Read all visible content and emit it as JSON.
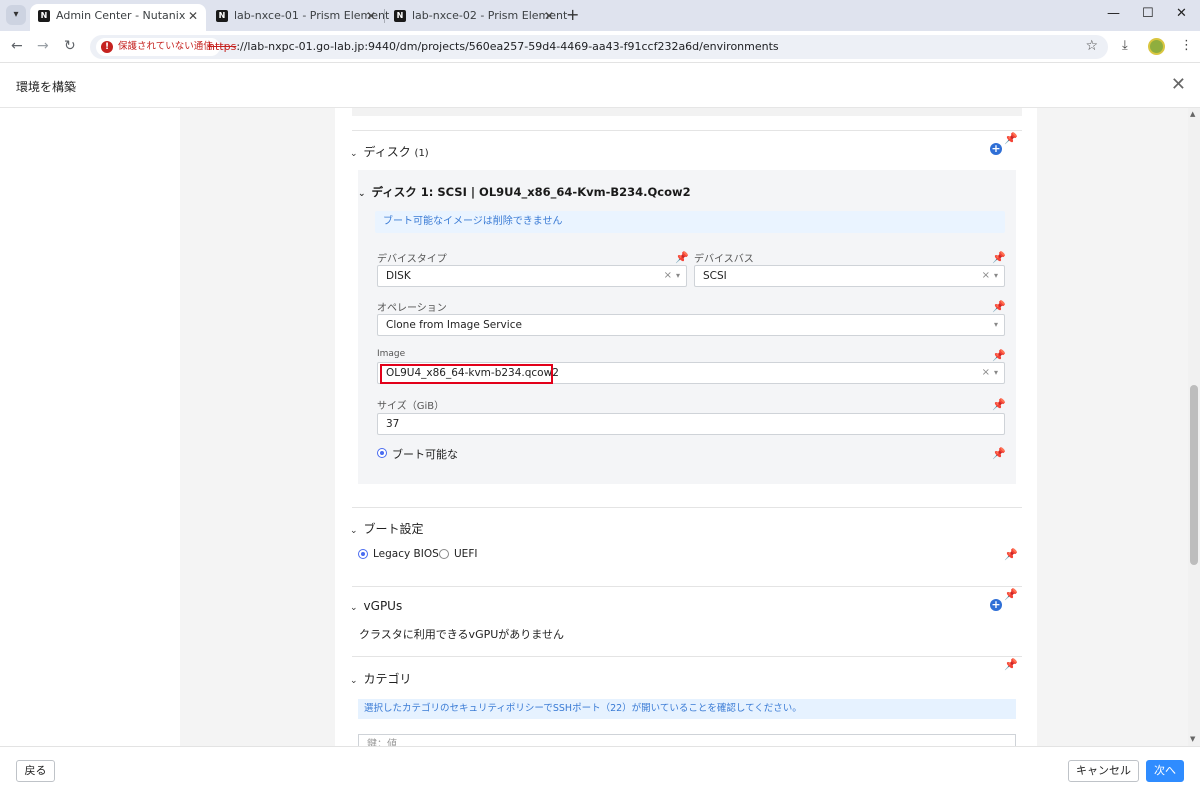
{
  "browser": {
    "tabs": [
      {
        "title": "Admin Center - Nutanix",
        "favicon": "N",
        "active": true
      },
      {
        "title": "lab-nxce-01 - Prism Element",
        "favicon": "N",
        "active": false
      },
      {
        "title": "lab-nxce-02 - Prism Element",
        "favicon": "N",
        "active": false
      }
    ],
    "security_label": "保護されていない通信",
    "url_proto": "https",
    "url_rest": "://lab-nxpc-01.go-lab.jp:9440/dm/projects/560ea257-59d4-4469-aa43-f91ccf232a6d/environments",
    "icons": {
      "tab_menu": "▾",
      "close": "✕",
      "new_tab": "+",
      "back": "←",
      "forward": "→",
      "reload": "↻",
      "star": "☆",
      "download": "⤓",
      "menu": "⋮",
      "minimize": "—",
      "maximize": "☐",
      "window_close": "✕"
    }
  },
  "header": {
    "title": "環境を構築",
    "close_glyph": "✕"
  },
  "icons": {
    "pin": "📌",
    "plus": "+",
    "chevron": "⌄",
    "clear": "×",
    "caret": "▾",
    "scroll_up": "▲",
    "scroll_down": "▼"
  },
  "disks": {
    "title": "ディスク",
    "count": "(1)",
    "disk1": {
      "title": "ディスク 1: SCSI | OL9U4_x86_64-Kvm-B234.Qcow2",
      "banner": "ブート可能なイメージは削除できません",
      "device_type_label": "デバイスタイプ",
      "device_type_value": "DISK",
      "device_bus_label": "デバイスバス",
      "device_bus_value": "SCSI",
      "operation_label": "オペレーション",
      "operation_value": "Clone from Image Service",
      "image_label": "Image",
      "image_value": "OL9U4_x86_64-kvm-b234.qcow2",
      "size_label": "サイズ（GiB）",
      "size_value": "37",
      "bootable_label": "ブート可能な",
      "bootable_checked": true
    }
  },
  "boot": {
    "title": "ブート設定",
    "options": [
      {
        "label": "Legacy BIOS",
        "selected": true
      },
      {
        "label": "UEFI",
        "selected": false
      }
    ]
  },
  "vgpus": {
    "title": "vGPUs",
    "empty_text": "クラスタに利用できるvGPUがありません"
  },
  "categories": {
    "title": "カテゴリ",
    "banner": "選択したカテゴリのセキュリティポリシーでSSHポート（22）が開いていることを確認してください。",
    "placeholder": "鍵：値"
  },
  "footer": {
    "back_label": "戻る",
    "cancel_label": "キャンセル",
    "next_label": "次へ"
  }
}
